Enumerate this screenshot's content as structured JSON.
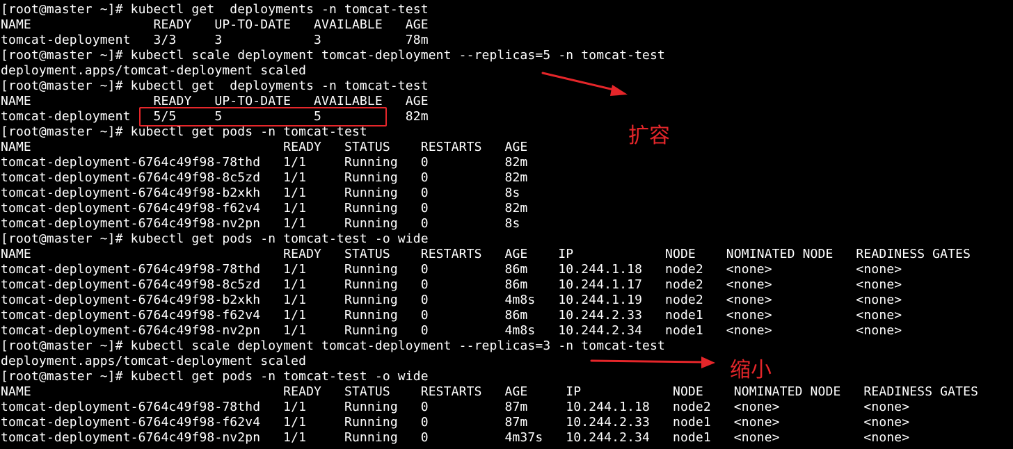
{
  "terminal": {
    "lines": [
      "[root@master ~]# kubectl get  deployments -n tomcat-test",
      "NAME                READY   UP-TO-DATE   AVAILABLE   AGE",
      "tomcat-deployment   3/3     3            3           78m",
      "[root@master ~]# kubectl scale deployment tomcat-deployment --replicas=5 -n tomcat-test",
      "deployment.apps/tomcat-deployment scaled",
      "[root@master ~]# kubectl get  deployments -n tomcat-test",
      "NAME                READY   UP-TO-DATE   AVAILABLE   AGE",
      "tomcat-deployment   5/5     5            5           82m",
      "[root@master ~]# kubectl get pods -n tomcat-test",
      "NAME                                 READY   STATUS    RESTARTS   AGE",
      "tomcat-deployment-6764c49f98-78thd   1/1     Running   0          82m",
      "tomcat-deployment-6764c49f98-8c5zd   1/1     Running   0          82m",
      "tomcat-deployment-6764c49f98-b2xkh   1/1     Running   0          8s",
      "tomcat-deployment-6764c49f98-f62v4   1/1     Running   0          82m",
      "tomcat-deployment-6764c49f98-nv2pn   1/1     Running   0          8s",
      "[root@master ~]# kubectl get pods -n tomcat-test -o wide",
      "NAME                                 READY   STATUS    RESTARTS   AGE    IP            NODE    NOMINATED NODE   READINESS GATES",
      "tomcat-deployment-6764c49f98-78thd   1/1     Running   0          86m    10.244.1.18   node2   <none>           <none>",
      "tomcat-deployment-6764c49f98-8c5zd   1/1     Running   0          86m    10.244.1.17   node2   <none>           <none>",
      "tomcat-deployment-6764c49f98-b2xkh   1/1     Running   0          4m8s   10.244.1.19   node2   <none>           <none>",
      "tomcat-deployment-6764c49f98-f62v4   1/1     Running   0          86m    10.244.2.33   node1   <none>           <none>",
      "tomcat-deployment-6764c49f98-nv2pn   1/1     Running   0          4m8s   10.244.2.34   node1   <none>           <none>",
      "[root@master ~]# kubectl scale deployment tomcat-deployment --replicas=3 -n tomcat-test",
      "deployment.apps/tomcat-deployment scaled",
      "[root@master ~]# kubectl get pods -n tomcat-test -o wide",
      "NAME                                 READY   STATUS    RESTARTS   AGE     IP            NODE    NOMINATED NODE   READINESS GATES",
      "tomcat-deployment-6764c49f98-78thd   1/1     Running   0          87m     10.244.1.18   node2   <none>           <none>",
      "tomcat-deployment-6764c49f98-f62v4   1/1     Running   0          87m     10.244.2.33   node1   <none>           <none>",
      "tomcat-deployment-6764c49f98-nv2pn   1/1     Running   0          4m37s   10.244.2.34   node1   <none>           <none>"
    ]
  },
  "annotations": {
    "scale_up_label": "扩容",
    "scale_down_label": "缩小"
  },
  "colors": {
    "background": "#000000",
    "text": "#ffffff",
    "annotation": "#e5262a"
  }
}
